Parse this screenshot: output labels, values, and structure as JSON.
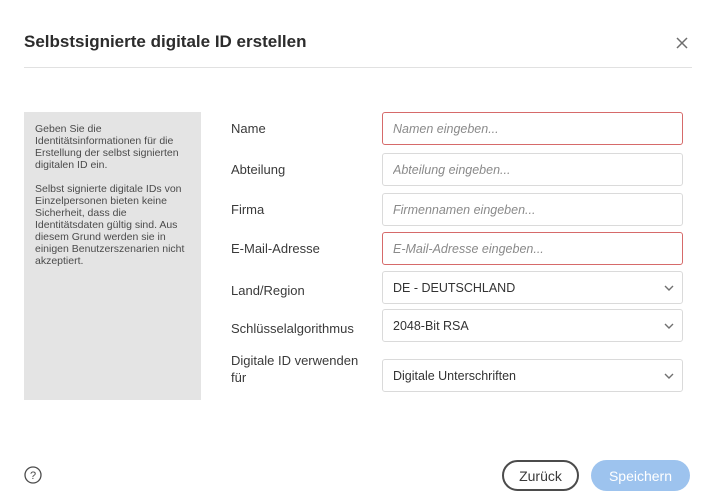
{
  "dialog": {
    "title": "Selbstsignierte digitale ID erstellen",
    "close_icon": "close-icon"
  },
  "info": {
    "paragraph1": "Geben Sie die Identitätsinformationen für die Erstellung der selbst signierten digitalen ID ein.",
    "paragraph2": "Selbst signierte digitale IDs von Einzelpersonen bieten keine Sicherheit, dass die Identitätsdaten gültig sind. Aus diesem Grund werden sie in einigen Benutzerszenarien nicht akzeptiert."
  },
  "form": {
    "name": {
      "label": "Name",
      "value": "",
      "placeholder": "Namen eingeben..."
    },
    "department": {
      "label": "Abteilung",
      "value": "",
      "placeholder": "Abteilung eingeben..."
    },
    "company": {
      "label": "Firma",
      "value": "",
      "placeholder": "Firmennamen eingeben..."
    },
    "email": {
      "label": "E-Mail-Adresse",
      "value": "",
      "placeholder": "E-Mail-Adresse eingeben..."
    },
    "country": {
      "label": "Land/Region",
      "selected": "DE - DEUTSCHLAND"
    },
    "algorithm": {
      "label": "Schlüsselalgorithmus",
      "selected": "2048-Bit RSA"
    },
    "usage": {
      "label_line1": "Digitale ID verwenden",
      "label_line2": "für",
      "selected": "Digitale Unterschriften"
    }
  },
  "footer": {
    "help_icon": "help-icon",
    "back_label": "Zurück",
    "save_label": "Speichern"
  },
  "colors": {
    "accent_disabled": "#9dc3ee",
    "error_border": "#d66a6a",
    "panel_background": "#e4e4e4"
  }
}
